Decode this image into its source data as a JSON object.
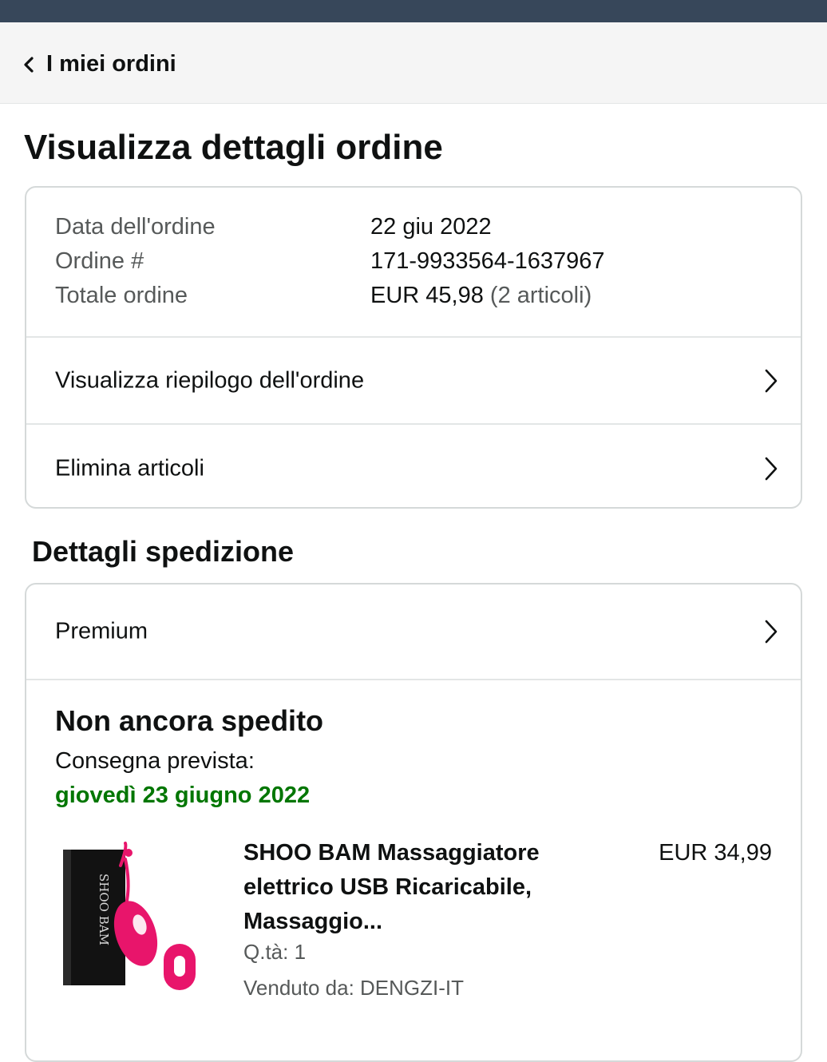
{
  "header": {
    "back_label": "I miei ordini"
  },
  "page": {
    "title": "Visualizza dettagli ordine"
  },
  "order": {
    "date_label": "Data dell'ordine",
    "date_value": "22 giu 2022",
    "number_label": "Ordine #",
    "number_value": "171-9933564-1637967",
    "total_label": "Totale ordine",
    "total_value": "EUR 45,98",
    "total_count": "(2 articoli)"
  },
  "links": {
    "summary": "Visualizza riepilogo dell'ordine",
    "delete": "Elimina articoli"
  },
  "shipping": {
    "section_title": "Dettagli spedizione",
    "method": "Premium",
    "status": "Non ancora spedito",
    "delivery_label": "Consegna prevista:",
    "delivery_date": "giovedì 23 giugno 2022"
  },
  "item": {
    "title": "SHOO BAM Massaggiatore elettrico USB Ricaricabile, Massaggio...",
    "price": "EUR 34,99",
    "qty": "Q.tà: 1",
    "seller": "Venduto da: DENGZI-IT",
    "brand_mark": "SHOO BAM"
  },
  "colors": {
    "topbar": "#37475a",
    "delivery_green": "#007600",
    "product_pink": "#e8156b"
  }
}
